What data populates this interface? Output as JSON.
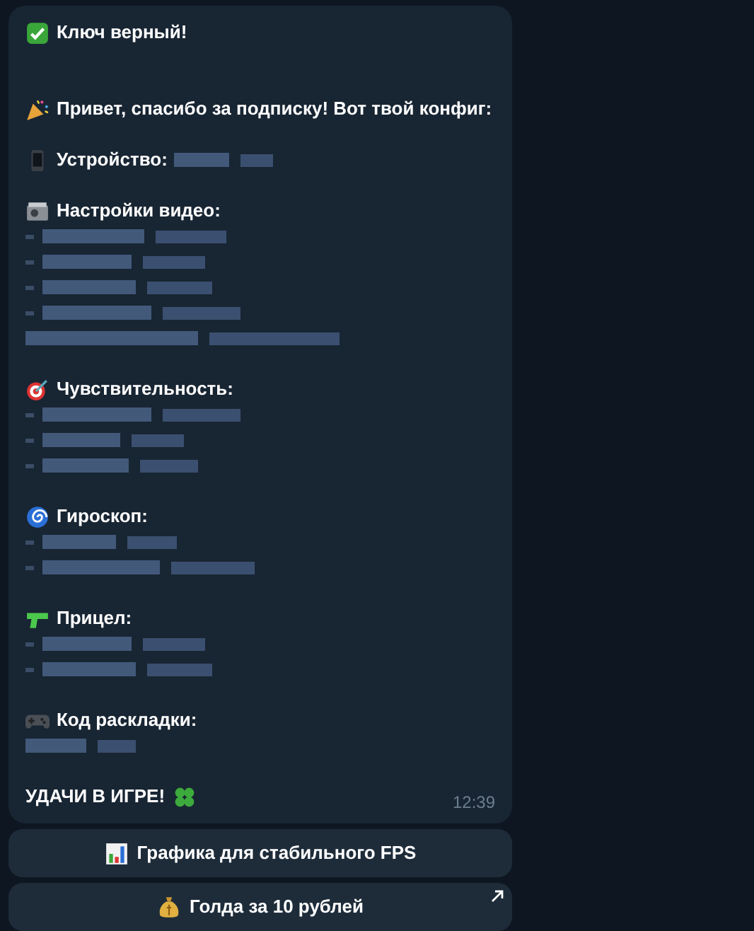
{
  "message": {
    "blocks": [
      {
        "text": "Ключ верный!"
      },
      {
        "text": "Привет, спасибо за подписку! Вот твой конфиг:"
      },
      {
        "text": "Устройство:",
        "inline_redacted": true
      },
      {
        "text": "Настройки видео:",
        "lines": [
          {
            "kind": "bulleted"
          },
          {
            "kind": "bulleted"
          },
          {
            "kind": "bulleted"
          },
          {
            "kind": "bulleted"
          },
          {
            "kind": "plain"
          }
        ]
      },
      {
        "text": "Чувствительность:",
        "lines": [
          {
            "kind": "bulleted"
          },
          {
            "kind": "bulleted"
          },
          {
            "kind": "bulleted"
          }
        ]
      },
      {
        "text": "Гироскоп:",
        "lines": [
          {
            "kind": "bulleted"
          },
          {
            "kind": "bulleted"
          }
        ]
      },
      {
        "text": "Прицел:",
        "lines": [
          {
            "kind": "bulleted"
          },
          {
            "kind": "bulleted"
          }
        ]
      },
      {
        "text": "Код раскладки:",
        "lines": [
          {
            "kind": "plain"
          }
        ]
      },
      {
        "text": "УДАЧИ В ИГРЕ!"
      }
    ],
    "time": "12:39"
  },
  "buttons": [
    {
      "label": "Графика для стабильного FPS",
      "external": false
    },
    {
      "label": "Голда за 10 рублей",
      "external": true
    }
  ]
}
